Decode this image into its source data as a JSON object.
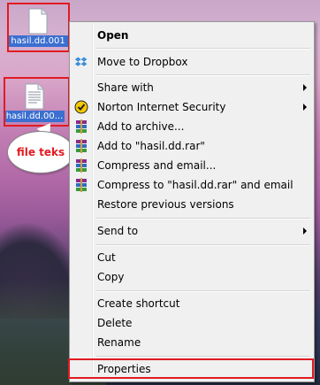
{
  "desktop": {
    "icons": [
      {
        "label": "hasil.dd.001"
      },
      {
        "label": "hasil.dd.00..."
      }
    ],
    "callout": "file teks"
  },
  "menu": {
    "items": [
      {
        "label": "Open",
        "bold": true
      },
      {
        "label": "Move to Dropbox",
        "icon": "dropbox-icon"
      },
      {
        "label": "Share with",
        "submenu": true
      },
      {
        "label": "Norton Internet Security",
        "icon": "norton-icon",
        "submenu": true
      },
      {
        "label": "Add to archive...",
        "icon": "winrar-icon"
      },
      {
        "label": "Add to \"hasil.dd.rar\"",
        "icon": "winrar-icon"
      },
      {
        "label": "Compress and email...",
        "icon": "winrar-icon"
      },
      {
        "label": "Compress to \"hasil.dd.rar\" and email",
        "icon": "winrar-icon"
      },
      {
        "label": "Restore previous versions"
      },
      {
        "label": "Send to",
        "submenu": true
      },
      {
        "label": "Cut"
      },
      {
        "label": "Copy"
      },
      {
        "label": "Create shortcut"
      },
      {
        "label": "Delete"
      },
      {
        "label": "Rename"
      },
      {
        "label": "Properties"
      }
    ]
  },
  "colors": {
    "highlight": "#e11b22",
    "selection": "#3b6fd0"
  }
}
